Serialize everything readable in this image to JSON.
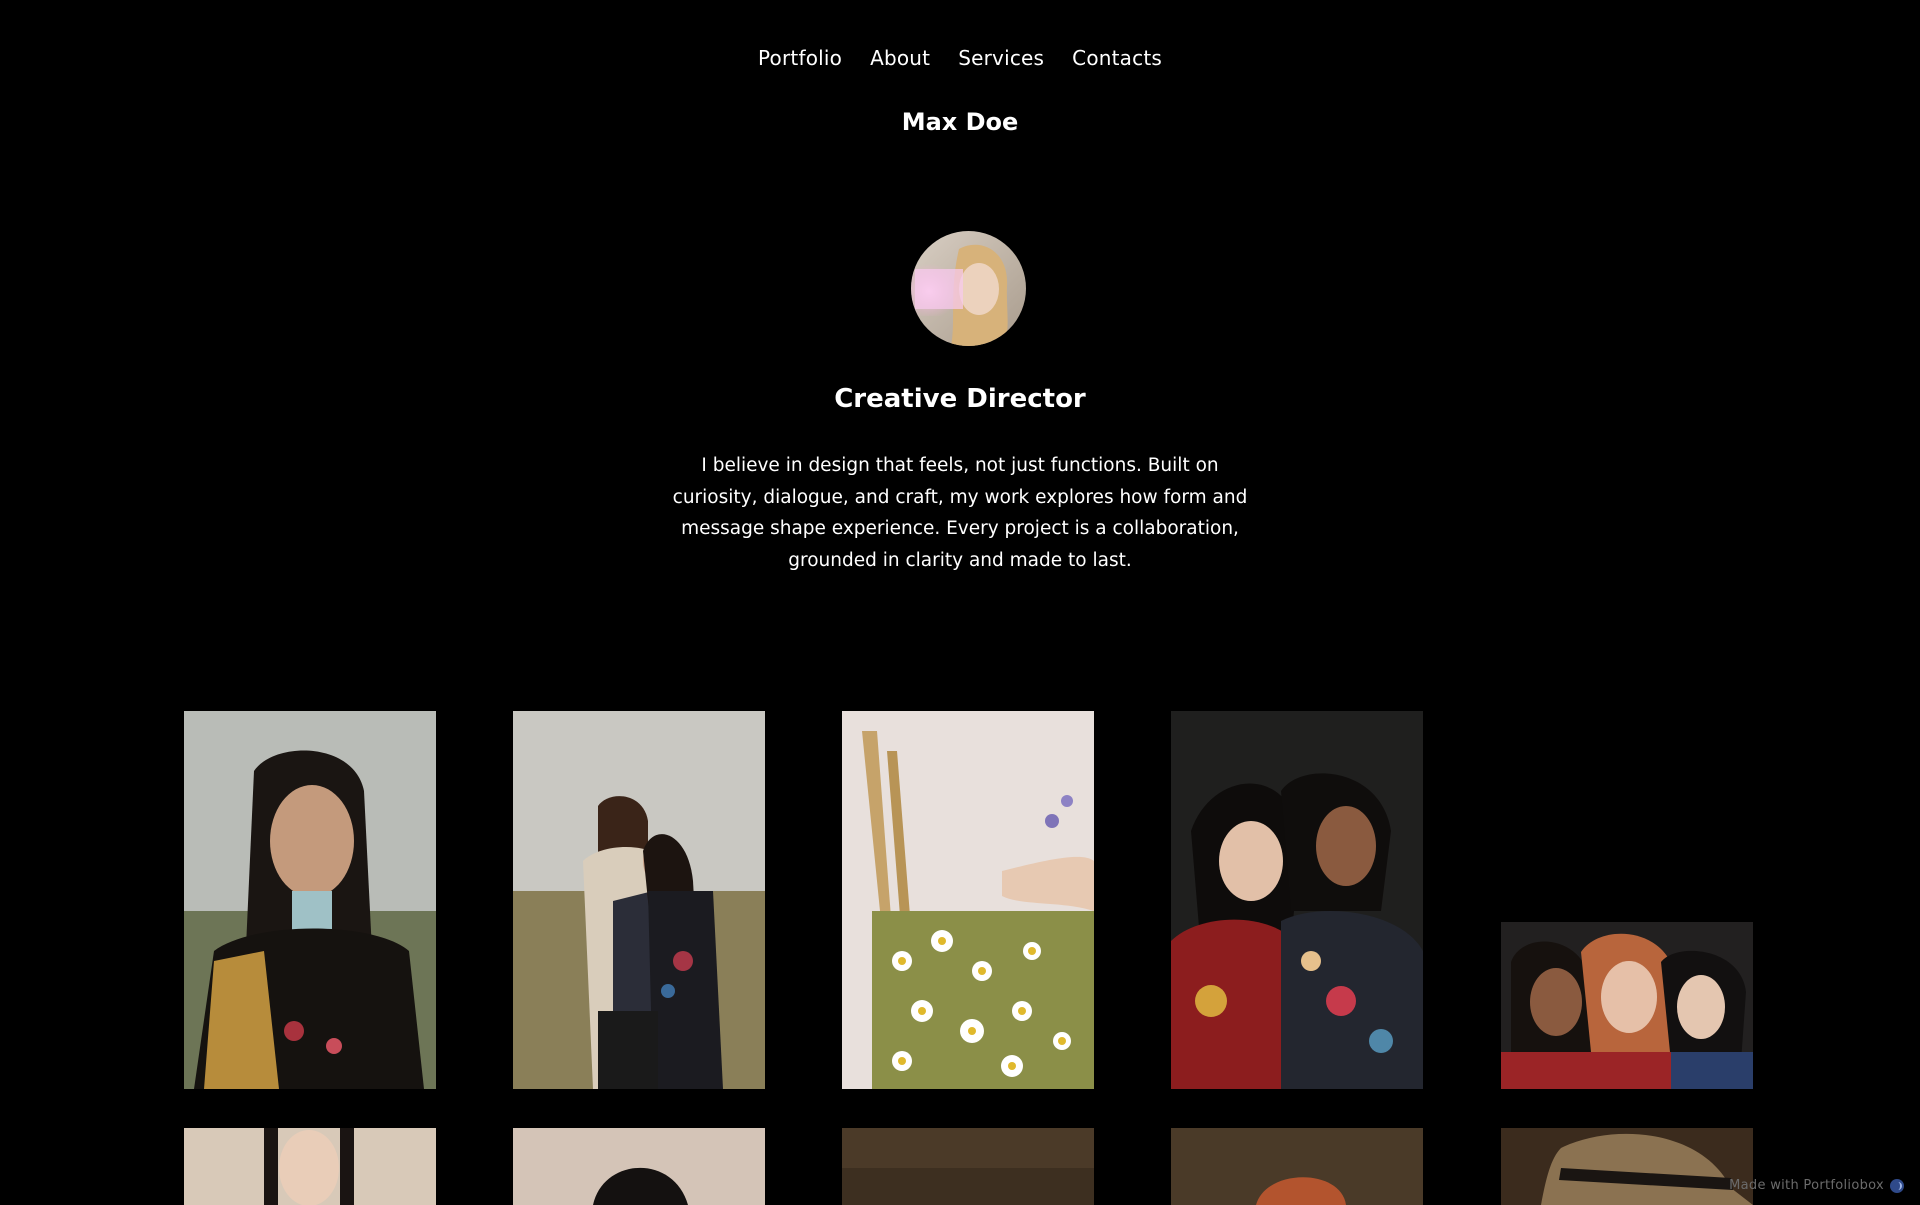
{
  "nav": {
    "items": [
      {
        "label": "Portfolio"
      },
      {
        "label": "About"
      },
      {
        "label": "Services"
      },
      {
        "label": "Contacts"
      }
    ]
  },
  "site": {
    "name": "Max Doe"
  },
  "profile": {
    "avatar_icon": "avatar-portrait",
    "role": "Creative Director",
    "bio": "I believe in design that feels, not just functions. Built on curiosity, dialogue, and craft, my work explores how form and message shape experience. Every project is a collaboration, grounded in clarity and made to last."
  },
  "gallery": {
    "photos": [
      {
        "subject": "woman-braids-field"
      },
      {
        "subject": "couple-in-field"
      },
      {
        "subject": "wildflower-bouquet"
      },
      {
        "subject": "two-women-embrace"
      },
      {
        "subject": "three-women-portrait"
      },
      {
        "subject": "woman-braids-beige"
      },
      {
        "subject": "woman-dark-hair-beige"
      },
      {
        "subject": "brown-still-life"
      },
      {
        "subject": "redhead-portrait"
      },
      {
        "subject": "straw-hat-portrait"
      }
    ]
  },
  "footer": {
    "badge_label": "Made with Portfoliobox",
    "badge_icon": "portfoliobox-logo-icon"
  },
  "colors": {
    "background": "#000000",
    "text": "#ffffff",
    "badge_text": "#6b6b6b"
  }
}
